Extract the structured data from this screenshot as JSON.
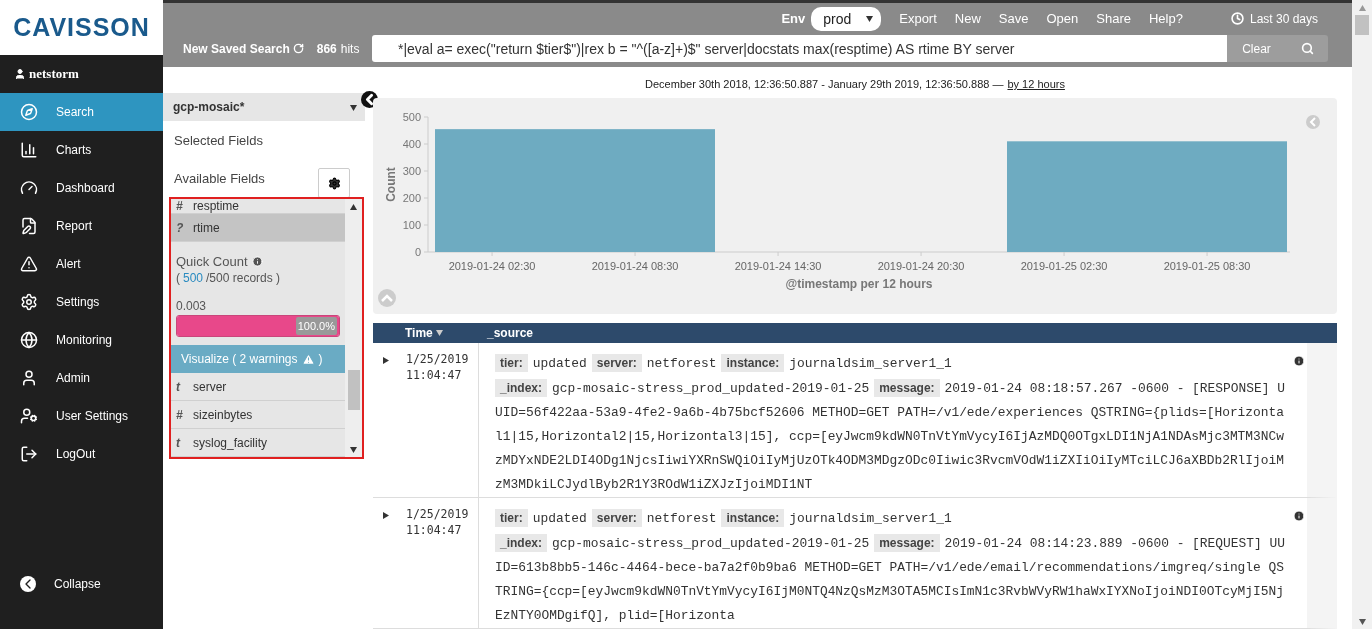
{
  "sidebar": {
    "logo": "CAVISSON",
    "user": "netstorm",
    "items": [
      {
        "label": "Search",
        "selected": true
      },
      {
        "label": "Charts",
        "selected": false
      },
      {
        "label": "Dashboard",
        "selected": false
      },
      {
        "label": "Report",
        "selected": false
      },
      {
        "label": "Alert",
        "selected": false
      },
      {
        "label": "Settings",
        "selected": false
      },
      {
        "label": "Monitoring",
        "selected": false
      },
      {
        "label": "Admin",
        "selected": false
      },
      {
        "label": "User Settings",
        "selected": false
      },
      {
        "label": "LogOut",
        "selected": false
      }
    ],
    "collapse": "Collapse"
  },
  "topbar": {
    "env_label": "Env",
    "env_value": "prod",
    "menu": [
      "Export",
      "New",
      "Save",
      "Open",
      "Share",
      "Help?"
    ],
    "time_range": "Last 30 days",
    "saved_search": "New Saved Search",
    "hits_count": "866",
    "hits_label": "hits",
    "query": "*|eval a= exec(\"return $tier$\")|rex b = \"^([a-z]+)$\" server|docstats max(resptime) AS rtime BY server",
    "clear": "Clear"
  },
  "fields_panel": {
    "index": "gcp-mosaic*",
    "selected_fields": "Selected Fields",
    "available_fields": "Available Fields",
    "fields_before": [
      {
        "type": "#",
        "name": "resptime",
        "selected": false
      },
      {
        "type": "?",
        "name": "rtime",
        "selected": true
      }
    ],
    "quick_count": {
      "title": "Quick Count",
      "open": "(",
      "count": "500",
      "rest": "/500 records )",
      "value": "0.003",
      "level": 1,
      "percent": "100.0%",
      "visualize": "Visualize ( 2 warnings",
      "visualize_end": ")"
    },
    "fields_after": [
      {
        "type": "t",
        "name": "server",
        "selected": false
      },
      {
        "type": "#",
        "name": "sizeinbytes",
        "selected": false
      },
      {
        "type": "t",
        "name": "syslog_facility",
        "selected": false
      }
    ]
  },
  "range": {
    "text": "December 30th 2018, 12:36:50.887 - January 29th 2019, 12:36:50.888 —",
    "link": "by 12 hours"
  },
  "chart_data": {
    "type": "bar",
    "xlabel": "@timestamp per 12 hours",
    "ylabel": "Count",
    "categories": [
      null,
      null,
      null
    ],
    "series": [
      {
        "color": "#6eabc1",
        "values": [
          455,
          null,
          410
        ]
      }
    ],
    "ylim": [
      0,
      500
    ],
    "yticks": [
      0,
      100,
      200,
      300,
      400,
      500
    ]
  },
  "time_labels": [
    "2019-01-24 02:30",
    "2019-01-24 08:30",
    "2019-01-24 14:30",
    "2019-01-24 20:30",
    "2019-01-25 02:30",
    "2019-01-25 08:30"
  ],
  "table": {
    "columns": [
      "Time",
      "_source"
    ],
    "rows": [
      {
        "time": "1/25/2019 11:04:47",
        "tags": [
          {
            "key": "tier:",
            "value": "updated"
          },
          {
            "key": "server:",
            "value": "netforest"
          },
          {
            "key": "instance:",
            "value": "journaldsim_server1_1"
          }
        ],
        "details": [
          {
            "key": "_index:",
            "value": "gcp-mosaic-stress_prod_updated-2019-01-25"
          },
          {
            "key": "message:",
            "value": "2019-01-24 08:18:57.267 -0600 - [RESPONSE] UUID=56f422aa-53a9-4fe2-9a6b-4b75bcf52606 METHOD=GET PATH=/v1/ede/experiences QSTRING={plids=[Horizontal1|15,Horizontal2|15,Horizontal3|15], ccp=[eyJwcm9kdWN0TnVtYmVycyI6IjAzMDQ0OTgxLDI1NjA1NDAsMjc3MTM3NCwzMDYxNDE2LDI4ODg1NjcsIiwiYXRnSWQiOiIyMjUzOTk4ODM3MDgzODc0Iiwic3RvcmVOdW1iZXIiOiIyMTciLCJ6aXBDb2RlIjoiMzM3MDkiLCJydlByb2R1Y3ROdW1iZXJzIjoiMDI1NT"
          }
        ]
      },
      {
        "time": "1/25/2019 11:04:47",
        "tags": [
          {
            "key": "tier:",
            "value": "updated"
          },
          {
            "key": "server:",
            "value": "netforest"
          },
          {
            "key": "instance:",
            "value": "journaldsim_server1_1"
          }
        ],
        "details": [
          {
            "key": "_index:",
            "value": "gcp-mosaic-stress_prod_updated-2019-01-25"
          },
          {
            "key": "message:",
            "value": "2019-01-24 08:14:23.889 -0600 - [REQUEST] UUID=613b8bb5-146c-4464-bece-ba7a2f0b9ba6 METHOD=GET PATH=/v1/ede/email/recommendations/imgreq/single QSTRING={ccp=[eyJwcm9kdWN0TnVtYmVycyI6IjM0NTQ4NzQsMzM3OTA5MCIsImN1c3RvbWVyRW1haWxIYXNoIjoiNDI0OTcyMjI5NjEzNTY0OMDgifQ], plid=[Horizonta"
          }
        ]
      }
    ]
  }
}
